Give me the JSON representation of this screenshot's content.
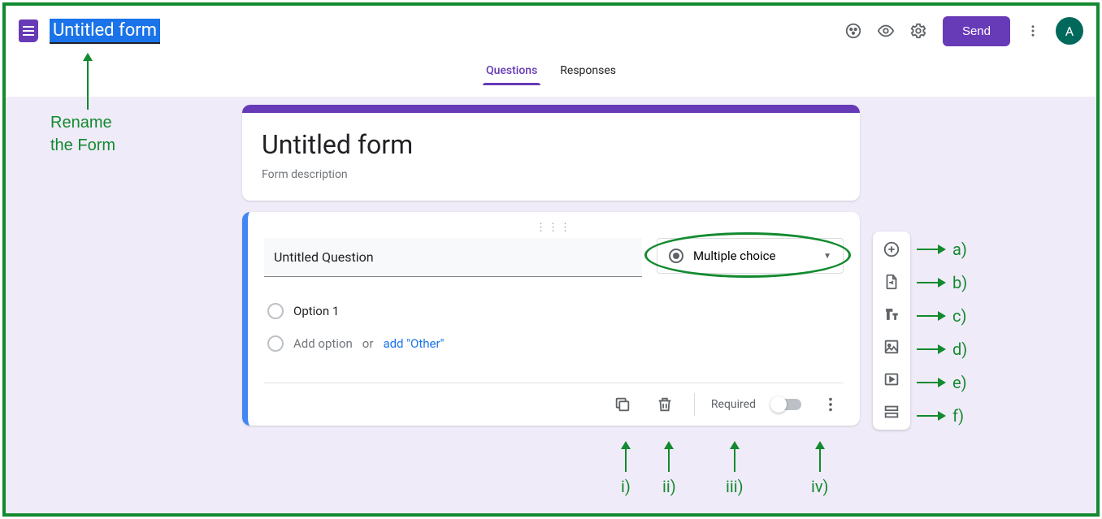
{
  "colors": {
    "accent": "#673ab7",
    "annotation": "#128a2f"
  },
  "header": {
    "title_editing": "Untitled form",
    "send_label": "Send",
    "avatar_initial": "A"
  },
  "tabs": {
    "questions": "Questions",
    "responses": "Responses"
  },
  "form": {
    "title": "Untitled form",
    "description_placeholder": "Form description"
  },
  "question": {
    "title": "Untitled Question",
    "type_label": "Multiple choice",
    "options": [
      "Option 1"
    ],
    "add_option_text": "Add option",
    "or_text": " or ",
    "add_other_text": "add \"Other\"",
    "required_label": "Required"
  },
  "annotations": {
    "rename_line1": "Rename",
    "rename_line2": "the Form",
    "side": [
      "a)",
      "b)",
      "c)",
      "d)",
      "e)",
      "f)"
    ],
    "bottom": [
      "i)",
      "ii)",
      "iii)",
      "iv)"
    ]
  }
}
